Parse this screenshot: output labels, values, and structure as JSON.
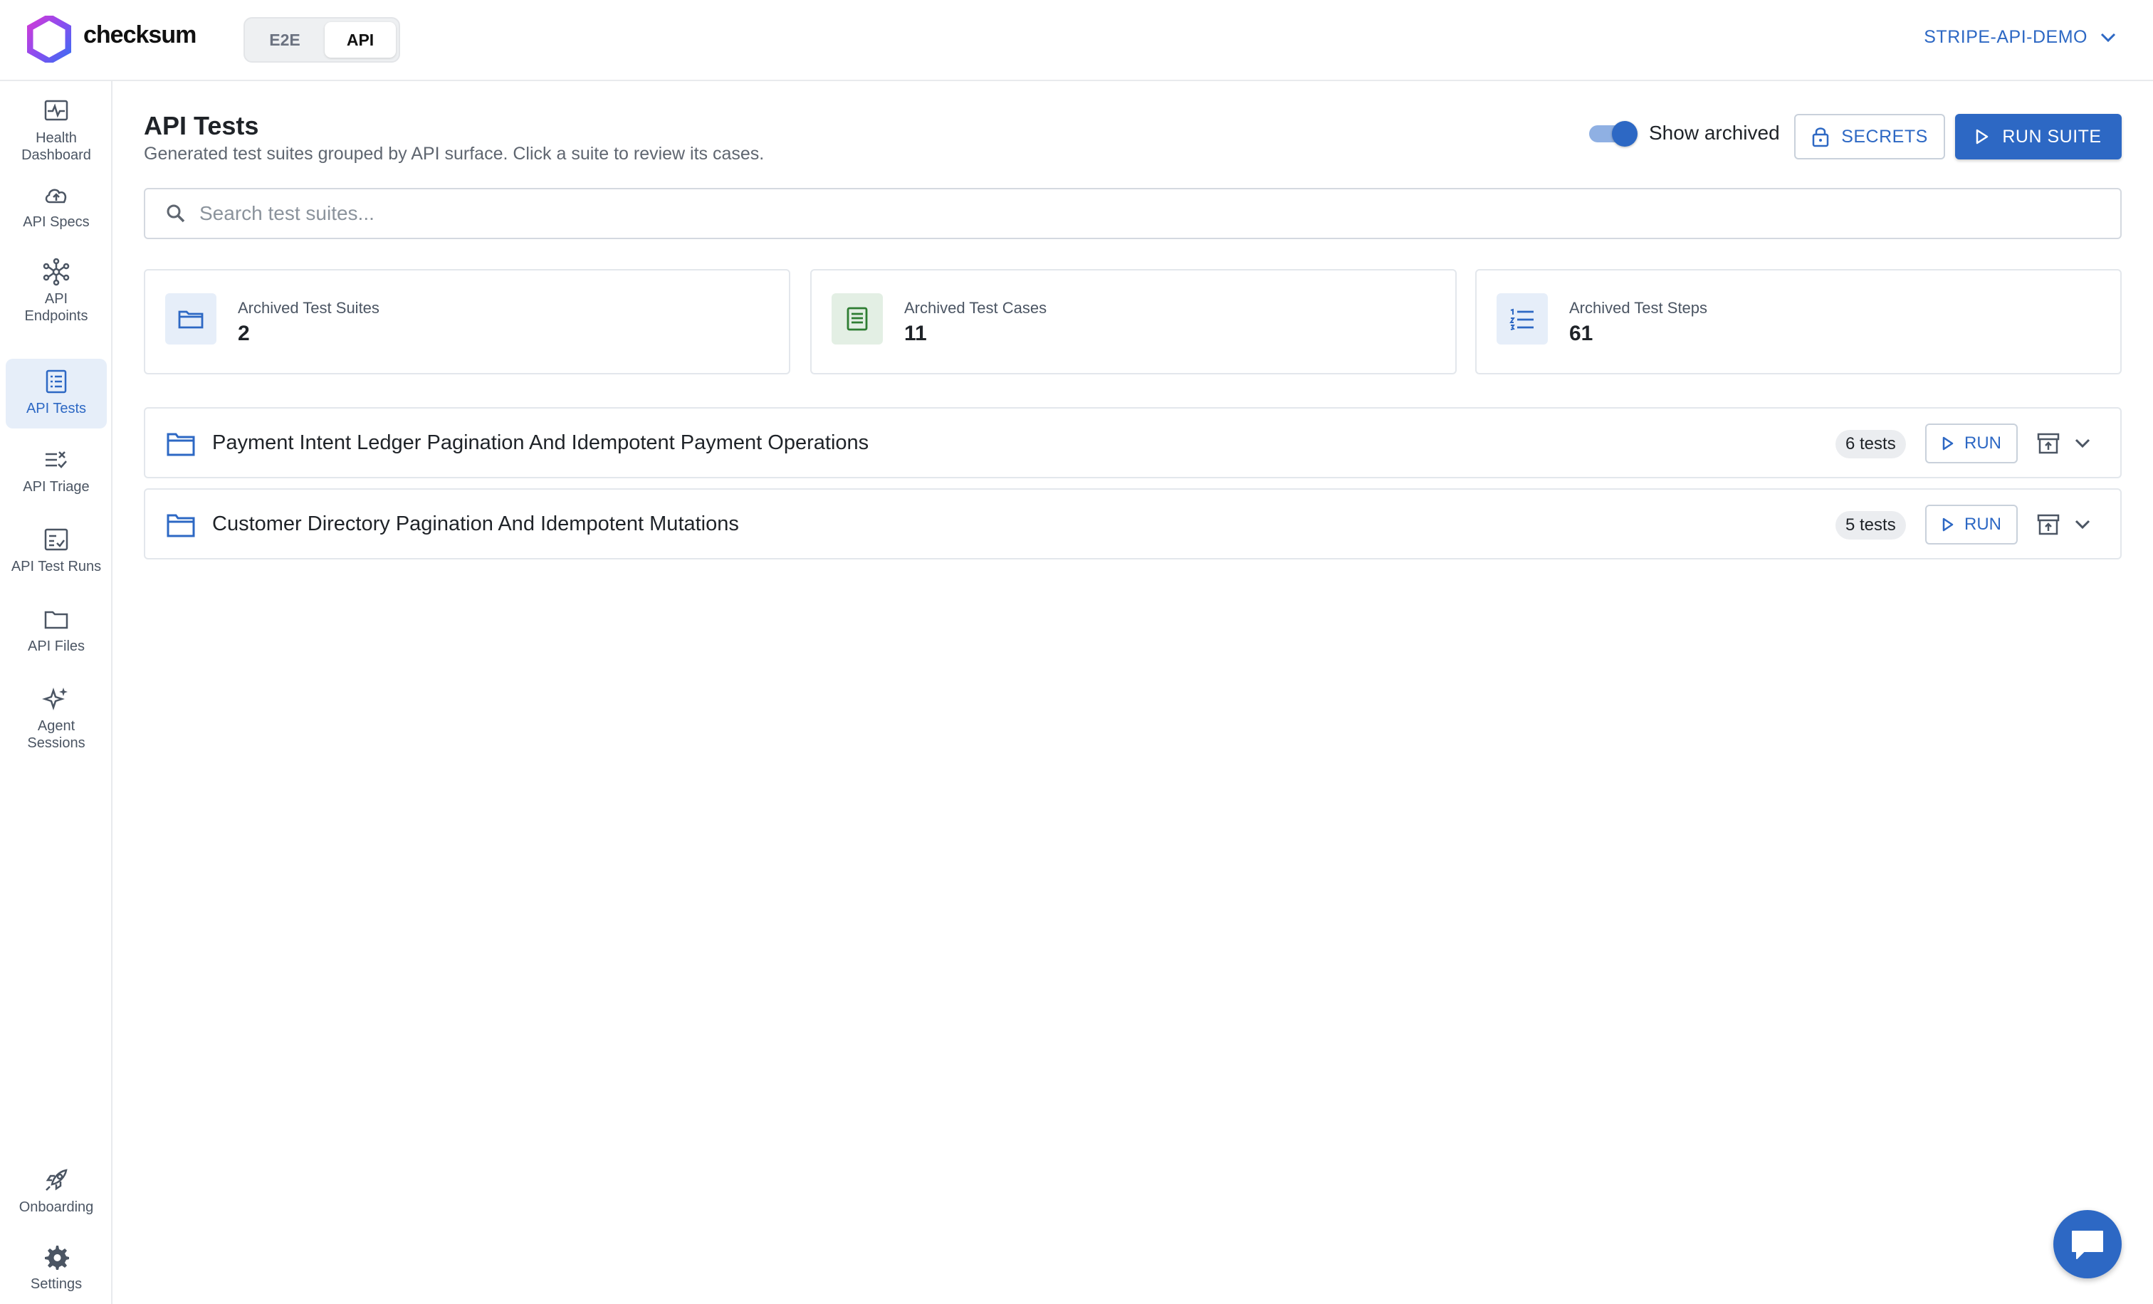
{
  "app": {
    "brand": "checksum",
    "modes": [
      "E2E",
      "API"
    ],
    "active_mode": "API",
    "org": "STRIPE-API-DEMO"
  },
  "sidebar": {
    "items": [
      {
        "label": "Health Dashboard",
        "icon": "pulse-icon"
      },
      {
        "label": "API Specs",
        "icon": "cloud-upload-icon"
      },
      {
        "label": "API Endpoints",
        "icon": "network-icon"
      },
      {
        "label": "API Tests",
        "icon": "list-icon",
        "active": true
      },
      {
        "label": "API Triage",
        "icon": "triage-icon"
      },
      {
        "label": "API Test Runs",
        "icon": "checklist-icon"
      },
      {
        "label": "API Files",
        "icon": "folder-icon"
      },
      {
        "label": "Agent Sessions",
        "icon": "sparkle-icon"
      }
    ],
    "bottom_items": [
      {
        "label": "Onboarding",
        "icon": "rocket-icon"
      },
      {
        "label": "Settings",
        "icon": "gear-icon"
      }
    ]
  },
  "page": {
    "title": "API Tests",
    "subtitle": "Generated test suites grouped by API surface. Click a suite to review its cases.",
    "show_archived_label": "Show archived",
    "show_archived": true,
    "secrets_label": "SECRETS",
    "run_suite_label": "RUN SUITE",
    "search_placeholder": "Search test suites..."
  },
  "stats": [
    {
      "label": "Archived Test Suites",
      "value": "2",
      "icon": "folder-icon",
      "bg": "#e6eef9",
      "color": "#2d68c4"
    },
    {
      "label": "Archived Test Cases",
      "value": "11",
      "icon": "document-icon",
      "bg": "#e3efe4",
      "color": "#2e7d32"
    },
    {
      "label": "Archived Test Steps",
      "value": "61",
      "icon": "numbered-list-icon",
      "bg": "#e6eef9",
      "color": "#2d68c4"
    }
  ],
  "suites": [
    {
      "name": "Payment Intent Ledger Pagination And Idempotent Payment Operations",
      "count": "6 tests",
      "run_label": "RUN"
    },
    {
      "name": "Customer Directory Pagination And Idempotent Mutations",
      "count": "5 tests",
      "run_label": "RUN"
    }
  ],
  "colors": {
    "accent": "#2d68c4",
    "border": "#e3e7ec"
  }
}
